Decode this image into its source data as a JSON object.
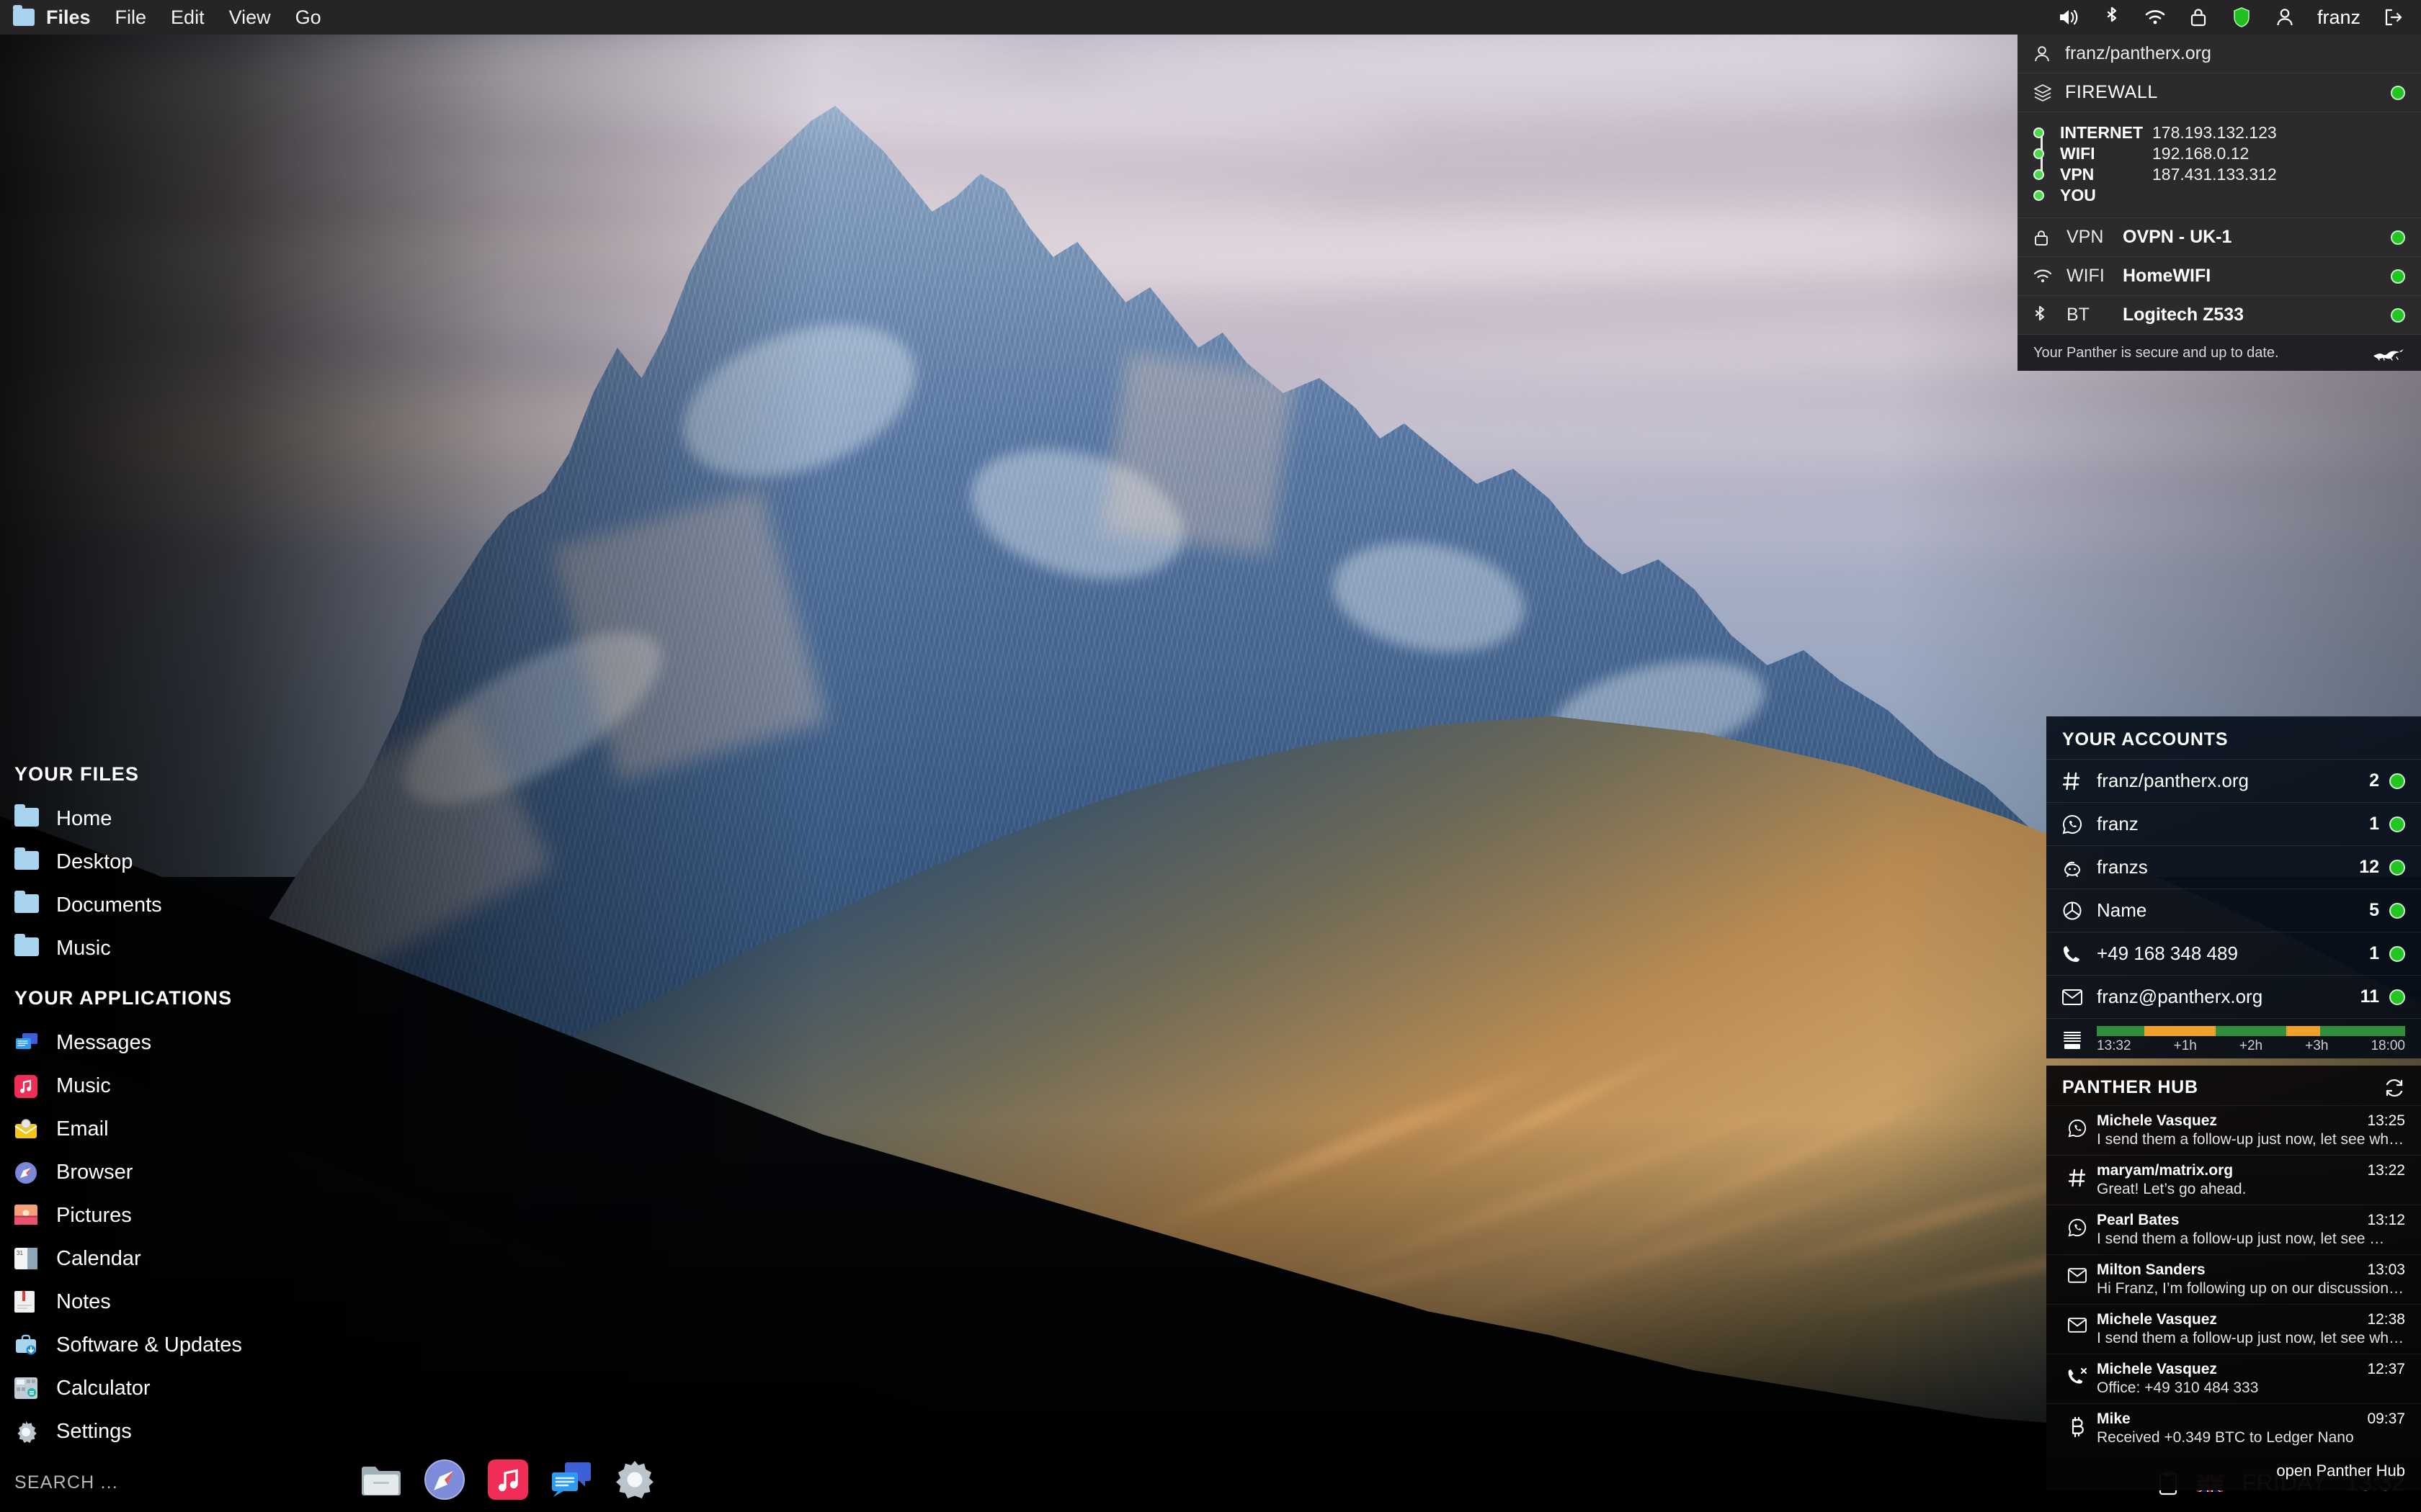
{
  "menubar": {
    "app_icon": "folder-icon",
    "app_name": "Files",
    "items": [
      "File",
      "Edit",
      "View",
      "Go"
    ],
    "tray_icons": [
      "volume-icon",
      "bluetooth-icon",
      "wifi-icon",
      "lock-icon",
      "shield-icon",
      "user-icon"
    ],
    "username": "franz",
    "logout_icon": "logout-icon"
  },
  "firewall": {
    "account": "franz/pantherx.org",
    "title": "FIREWALL",
    "status_color": "#22c522",
    "chain": [
      {
        "label": "INTERNET",
        "value": "178.193.132.123"
      },
      {
        "label": "WIFI",
        "value": "192.168.0.12"
      },
      {
        "label": "VPN",
        "value": "187.431.133.312"
      },
      {
        "label": "YOU",
        "value": ""
      }
    ],
    "services": [
      {
        "icon": "lock-icon",
        "key": "VPN",
        "value": "OVPN - UK-1"
      },
      {
        "icon": "wifi-icon",
        "key": "WIFI",
        "value": "HomeWIFI"
      },
      {
        "icon": "bluetooth-icon",
        "key": "BT",
        "value": "Logitech Z533"
      }
    ],
    "footer": "Your Panther is secure and up to date.",
    "footer_icon": "panther-logo"
  },
  "sidebar": {
    "files_heading": "YOUR FILES",
    "files": [
      {
        "label": "Home",
        "icon": "folder-icon"
      },
      {
        "label": "Desktop",
        "icon": "folder-icon"
      },
      {
        "label": "Documents",
        "icon": "folder-icon"
      },
      {
        "label": "Music",
        "icon": "folder-icon"
      }
    ],
    "apps_heading": "YOUR APPLICATIONS",
    "apps": [
      {
        "label": "Messages",
        "icon": "messages-icon",
        "color": "#2d7ff2"
      },
      {
        "label": "Music",
        "icon": "music-icon",
        "color": "#ef2d56"
      },
      {
        "label": "Email",
        "icon": "email-icon",
        "color": "#f5c518"
      },
      {
        "label": "Browser",
        "icon": "compass-icon",
        "color": "#7b88d6"
      },
      {
        "label": "Pictures",
        "icon": "pictures-icon",
        "color": "#f08a6a"
      },
      {
        "label": "Calendar",
        "icon": "calendar-icon",
        "color": "#c8d3dc"
      },
      {
        "label": "Notes",
        "icon": "notes-icon",
        "color": "#e8e8e8"
      },
      {
        "label": "Software & Updates",
        "icon": "toolbox-icon",
        "color": "#8fc4e8"
      },
      {
        "label": "Calculator",
        "icon": "calculator-icon",
        "color": "#b6bfc6"
      },
      {
        "label": "Settings",
        "icon": "gear-icon",
        "color": "#b9c4cc"
      }
    ]
  },
  "search": {
    "placeholder": "SEARCH ...",
    "value": ""
  },
  "dock": [
    {
      "name": "files-icon",
      "color": "#dfe4e6"
    },
    {
      "name": "browser-icon",
      "color": "#7b88d6"
    },
    {
      "name": "music-icon",
      "color": "#ef2d56"
    },
    {
      "name": "messages-icon",
      "color": "#2d7ff2"
    },
    {
      "name": "settings-icon",
      "color": "#b9c4cc"
    }
  ],
  "clock": {
    "clipboard_icon": "clipboard-icon",
    "flag_icon": "uk-flag-icon",
    "day": "FRIDAY",
    "time": "13:32"
  },
  "accounts": {
    "heading": "YOUR ACCOUNTS",
    "rows": [
      {
        "icon": "hash-icon",
        "name": "franz/pantherx.org",
        "count": "2",
        "status": "#22c522"
      },
      {
        "icon": "whatsapp-icon",
        "name": "franz",
        "count": "1",
        "status": "#22c522"
      },
      {
        "icon": "signal-icon",
        "name": "franzs",
        "count": "12",
        "status": "#22c522"
      },
      {
        "icon": "globe-icon",
        "name": "Name",
        "count": "5",
        "status": "#22c522"
      },
      {
        "icon": "phone-icon",
        "name": "+49 168 348 489",
        "count": "1",
        "status": "#22c522"
      },
      {
        "icon": "mail-icon",
        "name": "franz@pantherx.org",
        "count": "11",
        "status": "#22c522"
      }
    ],
    "timeline": {
      "icon": "agenda-icon",
      "ticks": [
        "13:32",
        "+1h",
        "+2h",
        "+3h",
        "18:00"
      ],
      "segments": [
        {
          "color": "#2f8f3a",
          "pct": 15.5
        },
        {
          "color": "#f0a028",
          "pct": 23.0
        },
        {
          "color": "#2f8f3a",
          "pct": 23.0
        },
        {
          "color": "#f0a028",
          "pct": 11.0
        },
        {
          "color": "#2f8f3a",
          "pct": 27.5
        }
      ]
    }
  },
  "hub": {
    "title": "PANTHER HUB",
    "refresh_icon": "refresh-icon",
    "items": [
      {
        "icon": "whatsapp-icon",
        "from": "Michele Vasquez",
        "time": "13:25",
        "preview": "I send them a follow-up just now, let see what …"
      },
      {
        "icon": "hash-icon",
        "from": "maryam/matrix.org",
        "time": "13:22",
        "preview": "Great! Let’s go ahead."
      },
      {
        "icon": "whatsapp-icon",
        "from": "Pearl Bates",
        "time": "13:12",
        "preview": "I send them a follow-up just now, let see …"
      },
      {
        "icon": "mail-icon",
        "from": "Milton Sanders",
        "time": "13:03",
        "preview": "Hi Franz, I’m following up on our discussion …"
      },
      {
        "icon": "mail-icon",
        "from": "Michele Vasquez",
        "time": "12:38",
        "preview": "I send them a follow-up just now, let see what …"
      },
      {
        "icon": "missed-call-icon",
        "from": "Michele Vasquez",
        "time": "12:37",
        "preview": "Office: +49 310 484 333"
      },
      {
        "icon": "bitcoin-icon",
        "from": "Mike",
        "time": "09:37",
        "preview": "Received +0.349 BTC to Ledger Nano"
      }
    ],
    "footer_link": "open Panther Hub"
  }
}
